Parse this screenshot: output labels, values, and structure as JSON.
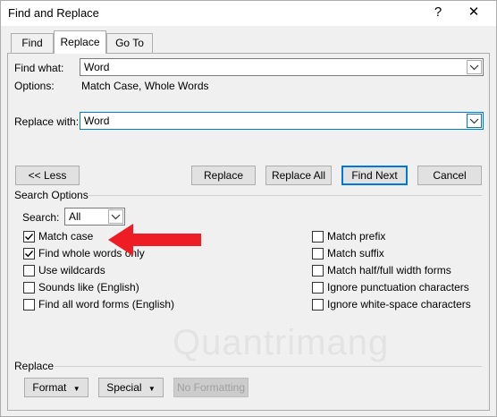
{
  "window": {
    "title": "Find and Replace",
    "help_glyph": "?",
    "close_glyph": "✕"
  },
  "tabs": [
    {
      "label": "Find",
      "active": false
    },
    {
      "label": "Replace",
      "active": true
    },
    {
      "label": "Go To",
      "active": false
    }
  ],
  "find": {
    "label": "Find what:",
    "value": "Word"
  },
  "options": {
    "label": "Options:",
    "value": "Match Case, Whole Words"
  },
  "replace": {
    "label": "Replace with:",
    "value": "Word"
  },
  "buttons": {
    "less": "<< Less",
    "replace": "Replace",
    "replace_all": "Replace All",
    "find_next": "Find Next",
    "cancel": "Cancel"
  },
  "search_options": {
    "heading": "Search Options",
    "search_label": "Search:",
    "search_value": "All",
    "left": [
      {
        "label": "Match case",
        "checked": true
      },
      {
        "label": "Find whole words only",
        "checked": true
      },
      {
        "label": "Use wildcards",
        "checked": false
      },
      {
        "label": "Sounds like (English)",
        "checked": false
      },
      {
        "label": "Find all word forms (English)",
        "checked": false
      }
    ],
    "right": [
      {
        "label": "Match prefix",
        "checked": false
      },
      {
        "label": "Match suffix",
        "checked": false
      },
      {
        "label": "Match half/full width forms",
        "checked": false
      },
      {
        "label": "Ignore punctuation characters",
        "checked": false
      },
      {
        "label": "Ignore white-space characters",
        "checked": false
      }
    ]
  },
  "replace_section": {
    "heading": "Replace",
    "format": "Format",
    "special": "Special",
    "no_formatting": "No Formatting"
  },
  "watermark": {
    "text": "Quantrimang"
  },
  "colors": {
    "accent": "#0078d7",
    "annotation_arrow": "#ee1c25"
  }
}
